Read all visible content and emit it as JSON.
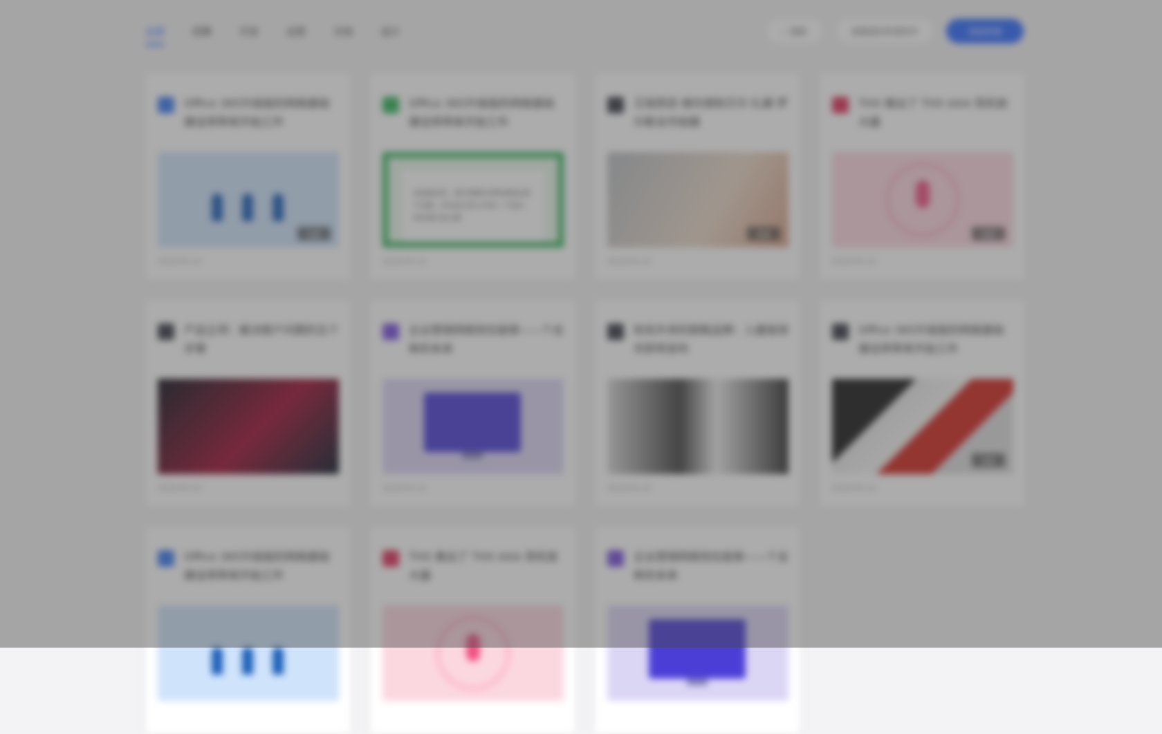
{
  "header": {
    "tabs": [
      {
        "label": "全部",
        "active": true
      },
      {
        "label": "招聘",
        "active": false
      },
      {
        "label": "开发",
        "active": false
      },
      {
        "label": "运营",
        "active": false
      },
      {
        "label": "文档",
        "active": false
      },
      {
        "label": "设计",
        "active": false
      }
    ],
    "search_label": "搜索",
    "outline_button_label": "查看我的申请条件",
    "primary_button_label": "发起申请"
  },
  "cards": [
    {
      "title": "Office 365升级版的网络基础建设将带来开始工作",
      "logo_color": "#3a7bf0",
      "thumb": "t-blue",
      "date": "2018.05.23",
      "badge": "免费"
    },
    {
      "title": "Office 365升级版的网络基础建设将带来开始工作",
      "logo_color": "#2fb45a",
      "thumb": "t-green",
      "date": "2018.05.23",
      "badge": ""
    },
    {
      "title": "艾丽西亚·维坎德和贝尔·扎娜·罗尔斯合作拍摄",
      "logo_color": "#3b3d4a",
      "thumb": "t-photo",
      "date": "2018.05.23",
      "badge": "免费"
    },
    {
      "title": "THX 推出了 THX AAA 耳机放大器",
      "logo_color": "#e0315a",
      "thumb": "t-pink",
      "date": "2018.05.23",
      "badge": "免费"
    },
    {
      "title": "产品立项：解决客户问题的五个步骤",
      "logo_color": "#3b3d4a",
      "thumb": "t-red",
      "date": "2018.05.23",
      "badge": ""
    },
    {
      "title": "企业营销网络现在能够——个全新的未来",
      "logo_color": "#7a4fdd",
      "thumb": "t-violet",
      "date": "2018.05.23",
      "badge": ""
    },
    {
      "title": "知名外资的跑鞋品牌：儿童版球衣即将发布",
      "logo_color": "#3b3d4a",
      "thumb": "t-sport",
      "date": "2018.05.23",
      "badge": ""
    },
    {
      "title": "Office 365升级版的网络基础建设将带来开始工作",
      "logo_color": "#3b3d4a",
      "thumb": "t-3d",
      "date": "2018.05.23",
      "badge": "免费"
    },
    {
      "title": "Office 365升级版的网络基础建设将带来开始工作",
      "logo_color": "#3a7bf0",
      "thumb": "t-blue",
      "date": "",
      "badge": ""
    },
    {
      "title": "THX 推出了 THX AAA 耳机放大器",
      "logo_color": "#e0315a",
      "thumb": "t-pink",
      "date": "",
      "badge": ""
    },
    {
      "title": "企业营销网络现在能够——个全新的未来",
      "logo_color": "#7a4fdd",
      "thumb": "t-violet",
      "date": "",
      "badge": ""
    }
  ],
  "thumb_texts": {
    "doc": "总结面试的，我们需要对求职者提出若干问题，并对自己的工作有一个初步，同时我们自己要"
  }
}
